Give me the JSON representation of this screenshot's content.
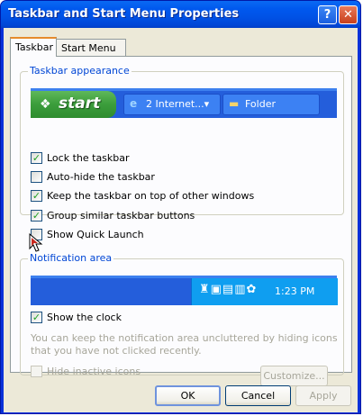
{
  "window": {
    "title": "Taskbar and Start Menu Properties",
    "help_glyph": "?",
    "close_glyph": "✕"
  },
  "tabs": [
    {
      "label": "Taskbar",
      "selected": true
    },
    {
      "label": "Start Menu",
      "selected": false
    }
  ],
  "taskbar_appearance": {
    "legend": "Taskbar appearance",
    "preview": {
      "start_label": "start",
      "items": [
        {
          "icon": "ie-icon",
          "label": "2 Internet...▾"
        },
        {
          "icon": "folder-icon",
          "label": "Folder"
        }
      ]
    },
    "options": [
      {
        "label": "Lock the taskbar",
        "checked": true
      },
      {
        "label": "Auto-hide the taskbar",
        "checked": false
      },
      {
        "label": "Keep the taskbar on top of other windows",
        "checked": true
      },
      {
        "label": "Group similar taskbar buttons",
        "checked": true
      },
      {
        "label": "Show Quick Launch",
        "checked": false
      }
    ]
  },
  "notification_area": {
    "legend": "Notification area",
    "tray_clock": "1:23 PM",
    "show_clock": {
      "label": "Show the clock",
      "checked": true
    },
    "hint": "You can keep the notification area uncluttered by hiding icons that you have not clicked recently.",
    "hide_inactive": {
      "label": "Hide inactive icons",
      "checked": false,
      "enabled": false
    },
    "customize_label": "Customize..."
  },
  "buttons": {
    "ok": "OK",
    "cancel": "Cancel",
    "apply": "Apply"
  },
  "colors": {
    "titlebar": "#0058ee",
    "dialog_bg": "#ece9d8",
    "checkmark": "#21a121",
    "group_legend": "#0046d5"
  }
}
